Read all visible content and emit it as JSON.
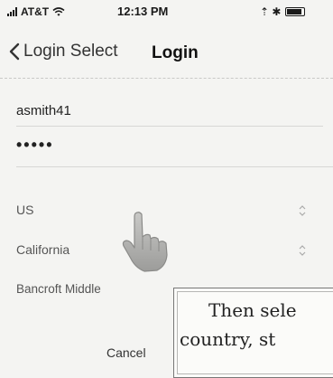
{
  "status_bar": {
    "carrier": "AT&T",
    "time": "12:13 PM",
    "right_symbols": "⇡ ✱"
  },
  "nav": {
    "back_label": "Login Select",
    "title": "Login"
  },
  "form": {
    "username_value": "asmith41",
    "password_value": "•••••"
  },
  "selects": {
    "country": "US",
    "state": "California",
    "school": "Bancroft Middle"
  },
  "actions": {
    "cancel_label": "Cancel"
  },
  "hint": {
    "line1": "Then sele",
    "line2": "country, st"
  },
  "colors": {
    "background": "#f4f4f2",
    "text": "#222222",
    "divider": "#d7d7d5"
  },
  "icons": {
    "back": "chevron-left-icon",
    "stepper": "up-down-chevron-icon",
    "cursor": "pointing-hand-icon"
  }
}
